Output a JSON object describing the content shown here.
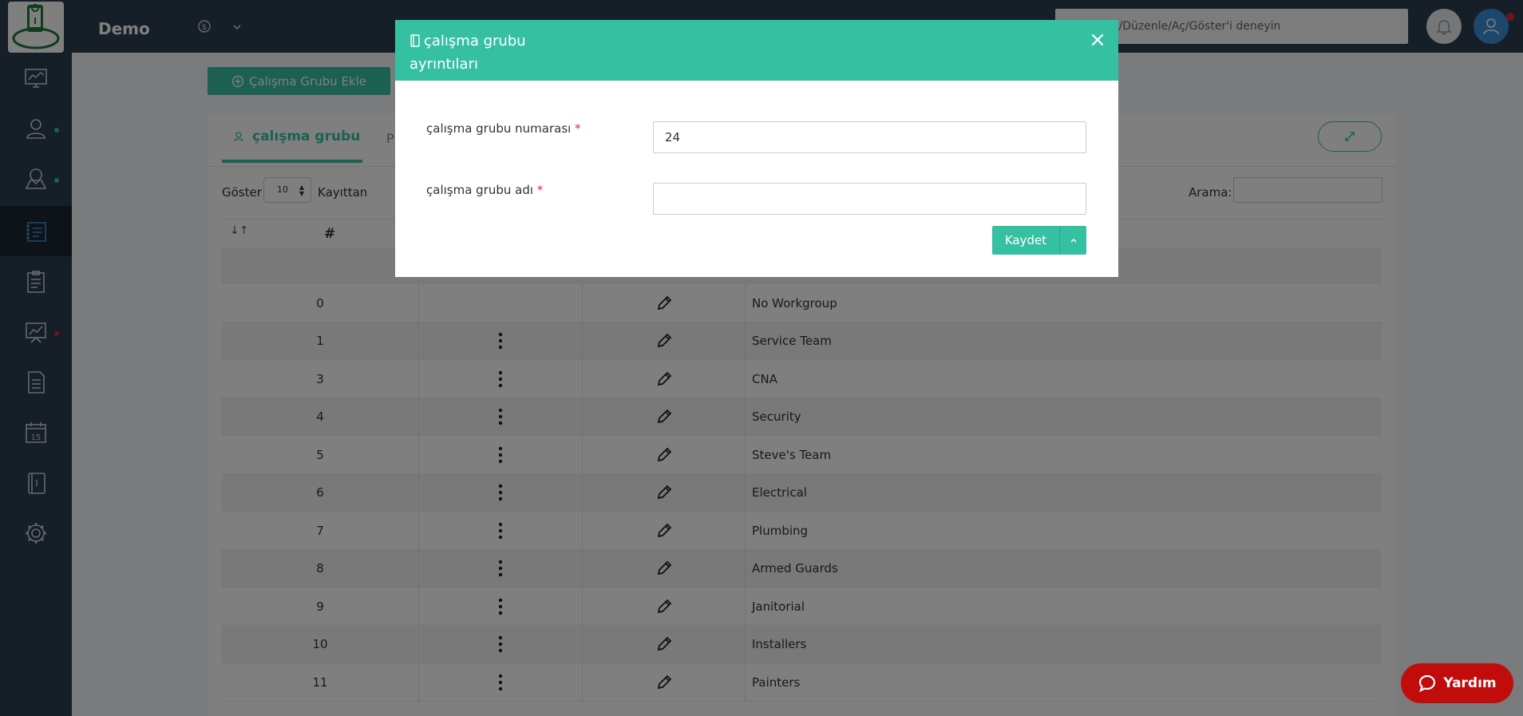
{
  "topbar": {
    "brand": "Demo",
    "search_placeholder": "Ekle/Düzenle/Aç/Göster'i deneyin"
  },
  "sidebar": {
    "items": [
      {
        "icon": "monitor-chart-icon"
      },
      {
        "icon": "user-icon"
      },
      {
        "icon": "map-pin-icon"
      },
      {
        "icon": "notebook-icon",
        "active": true
      },
      {
        "icon": "clipboard-icon"
      },
      {
        "icon": "presentation-chart-icon"
      },
      {
        "icon": "document-icon"
      },
      {
        "icon": "calendar-icon",
        "text": "15"
      },
      {
        "icon": "book-icon"
      },
      {
        "icon": "gear-icon"
      }
    ]
  },
  "main": {
    "add_button": "Çalışma Grubu Ekle",
    "tab_active": "çalışma grubu",
    "tab_other": "P",
    "show_label": "Göster",
    "page_size": "10",
    "records_label": "Kayıttan",
    "search_label": "Arama:",
    "table": {
      "header_num": "#",
      "rows": [
        {
          "id": "0",
          "name": "No Workgroup",
          "menu": false
        },
        {
          "id": "1",
          "name": "Service Team",
          "menu": true
        },
        {
          "id": "3",
          "name": "CNA",
          "menu": true
        },
        {
          "id": "4",
          "name": "Security",
          "menu": true
        },
        {
          "id": "5",
          "name": "Steve's Team",
          "menu": true
        },
        {
          "id": "6",
          "name": "Electrical",
          "menu": true
        },
        {
          "id": "7",
          "name": "Plumbing",
          "menu": true
        },
        {
          "id": "8",
          "name": "Armed Guards",
          "menu": true
        },
        {
          "id": "9",
          "name": "Janitorial",
          "menu": true
        },
        {
          "id": "10",
          "name": "Installers",
          "menu": true
        },
        {
          "id": "11",
          "name": "Painters",
          "menu": true
        }
      ]
    }
  },
  "modal": {
    "title": "çalışma grubu ayrıntıları",
    "field_number_label": "çalışma grubu numarası",
    "field_number_value": "24",
    "field_name_label": "çalışma grubu adı",
    "field_name_value": "",
    "required_mark": "*",
    "save_label": "Kaydet"
  },
  "help": {
    "label": "Yardım"
  },
  "colors": {
    "accent": "#36c0a2",
    "sidebar": "#2c3e50",
    "help": "#c10c0c",
    "badge_red": "#e7243b"
  }
}
